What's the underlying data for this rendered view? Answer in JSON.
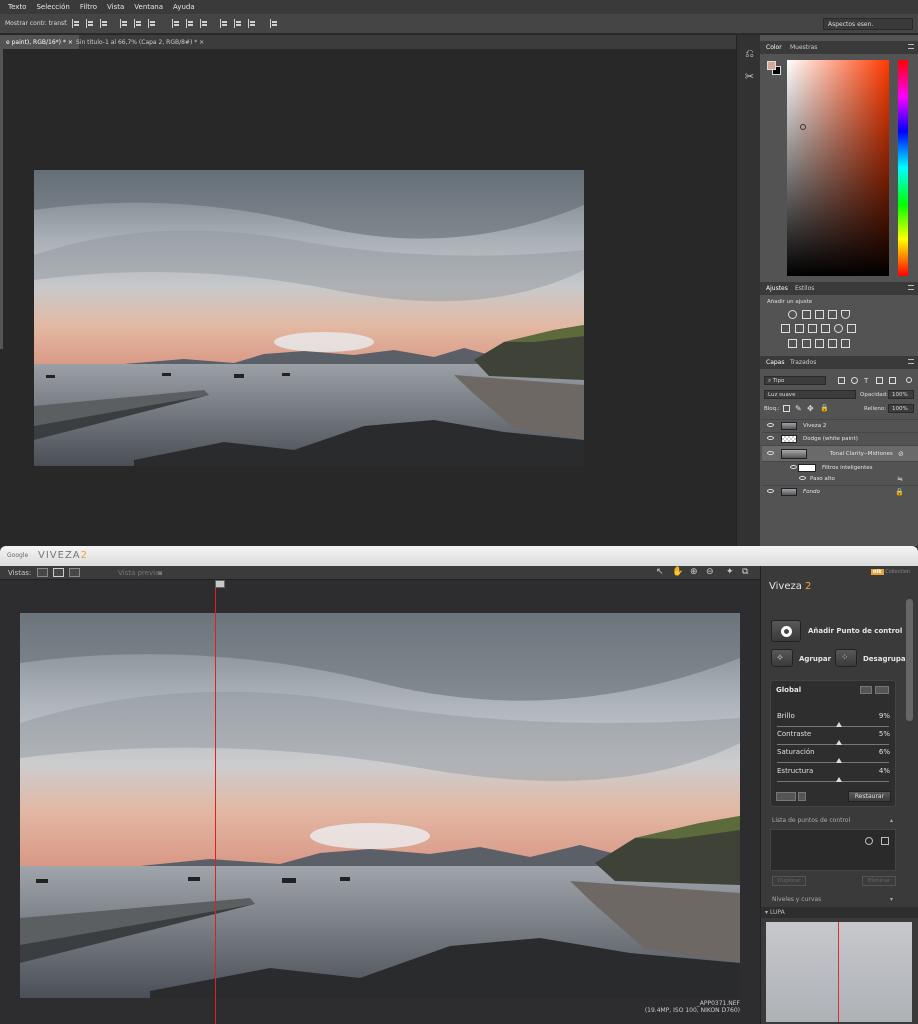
{
  "ps": {
    "menu": [
      "Texto",
      "Selección",
      "Filtro",
      "Vista",
      "Ventana",
      "Ayuda"
    ],
    "options_label": "Mostrar contr. transf.",
    "workspace": "Aspectos esen.",
    "tabs": [
      "e paint), RGB/16*) *",
      "Sin título-1 al 66,7% (Capa 2, RGB/8#) *"
    ],
    "color_panel": {
      "tabs": [
        "Color",
        "Muestras"
      ],
      "fg_color": "#d9a59b",
      "bg_color": "#000000"
    },
    "adjust_panel": {
      "tabs": [
        "Ajustes",
        "Estilos"
      ],
      "subtitle": "Añadir un ajuste"
    },
    "layers_panel": {
      "tabs": [
        "Capas",
        "Trazados"
      ],
      "filter": "Tipo",
      "blend_mode": "Luz suave",
      "opacity_label": "Opacidad:",
      "opacity": "100%",
      "lock_label": "Bloq.:",
      "fill_label": "Relleno:",
      "fill": "100%",
      "layers": [
        {
          "name": "Viveza 2"
        },
        {
          "name": "Dodge (white paint)"
        },
        {
          "name": "Tonal Clarity--Midtones"
        },
        {
          "name": "Filtros inteligentes"
        },
        {
          "name": "Paso alto"
        },
        {
          "name": "Fondo"
        }
      ]
    }
  },
  "vv": {
    "google": "Google",
    "app": "VIVEZA",
    "app_version": "2",
    "views_label": "Vistas:",
    "preview_label": "Vista previa",
    "brand": "Viveza",
    "brand_num": "2",
    "nik_badge": "nik",
    "nik_label": "Collection",
    "add_point": "Añadir Punto de control",
    "group": "Agrupar",
    "ungroup": "Desagrupar",
    "global_title": "Global",
    "sliders": [
      {
        "name": "Brillo",
        "value": "9%",
        "level": 0.55
      },
      {
        "name": "Contraste",
        "value": "5%",
        "level": 0.55
      },
      {
        "name": "Saturación",
        "value": "6%",
        "level": 0.55
      },
      {
        "name": "Estructura",
        "value": "4%",
        "level": 0.55
      }
    ],
    "restore": "Restaurar",
    "points_list": "Lista de puntos de control",
    "dup_button": "Duplicar",
    "del_button": "Eliminar",
    "levels_curves": "Niveles y curvas",
    "loupe": "LUPA",
    "filename": "_APP0371.NEF",
    "fileinfo": "(19.4MP, ISO 100, NIKON D760)"
  }
}
